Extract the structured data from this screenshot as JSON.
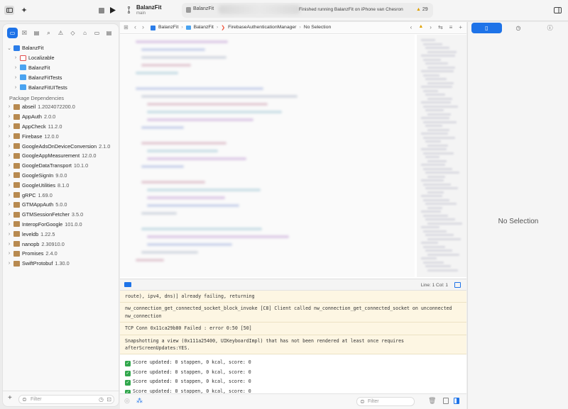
{
  "toolbar": {
    "scheme_name": "BalanzFit",
    "branch": "main",
    "run_destination": "BalanzFit",
    "status_message": "Finished running BalanzFit on iPhone van Chesron",
    "warning_count": "29"
  },
  "navigator": {
    "project": "BalanzFit",
    "items": [
      {
        "label": "Localizable",
        "icon": "localizable-icon"
      },
      {
        "label": "BalanzFit",
        "icon": "folder-icon"
      },
      {
        "label": "BalanzFitTests",
        "icon": "folder-icon"
      },
      {
        "label": "BalanzFitUITests",
        "icon": "folder-icon"
      }
    ],
    "section_label": "Package Dependencies",
    "packages": [
      {
        "name": "abseil",
        "version": "1.2024072200.0"
      },
      {
        "name": "AppAuth",
        "version": "2.0.0"
      },
      {
        "name": "AppCheck",
        "version": "11.2.0"
      },
      {
        "name": "Firebase",
        "version": "12.0.0"
      },
      {
        "name": "GoogleAdsOnDeviceConversion",
        "version": "2.1.0"
      },
      {
        "name": "GoogleAppMeasurement",
        "version": "12.0.0"
      },
      {
        "name": "GoogleDataTransport",
        "version": "10.1.0"
      },
      {
        "name": "GoogleSignIn",
        "version": "9.0.0"
      },
      {
        "name": "GoogleUtilities",
        "version": "8.1.0"
      },
      {
        "name": "gRPC",
        "version": "1.69.0"
      },
      {
        "name": "GTMAppAuth",
        "version": "5.0.0"
      },
      {
        "name": "GTMSessionFetcher",
        "version": "3.5.0"
      },
      {
        "name": "InteropForGoogle",
        "version": "101.0.0"
      },
      {
        "name": "leveldb",
        "version": "1.22.5"
      },
      {
        "name": "nanopb",
        "version": "2.30910.0"
      },
      {
        "name": "Promises",
        "version": "2.4.0"
      },
      {
        "name": "SwiftProtobuf",
        "version": "1.30.0"
      }
    ],
    "filter_placeholder": "Filter"
  },
  "jumpbar": {
    "crumbs": [
      "BalanzFit",
      "BalanzFit",
      "FirebaseAuthenticationManager",
      "No Selection"
    ]
  },
  "debugbar": {
    "position": "Line: 1  Col: 1"
  },
  "console": {
    "warnings": [
      "route), ipv4, dns)] already failing, returning",
      "nw_connection_get_connected_socket_block_invoke [C8] Client called nw_connection_get_connected_socket on unconnected nw_connection",
      "TCP Conn 0x11ca29b80 Failed : error 0:50 [50]",
      "Snapshotting a view (0x111a25400, UIKeyboardImpl) that has not been rendered at least once requires afterScreenUpdates:YES."
    ],
    "messages": [
      "Score updated: 0 stappen, 0 kcal, score: 0",
      "Score updated: 0 stappen, 0 kcal, score: 0",
      "Score updated: 0 stappen, 0 kcal, score: 0",
      "Score updated: 0 stappen, 0 kcal, score: 0"
    ],
    "filter_placeholder": "Filter"
  },
  "inspector": {
    "empty_message": "No Selection"
  },
  "colors": {
    "accent": "#1e73e8",
    "warning_bg": "#fdf6e3",
    "success": "#31a74c"
  }
}
